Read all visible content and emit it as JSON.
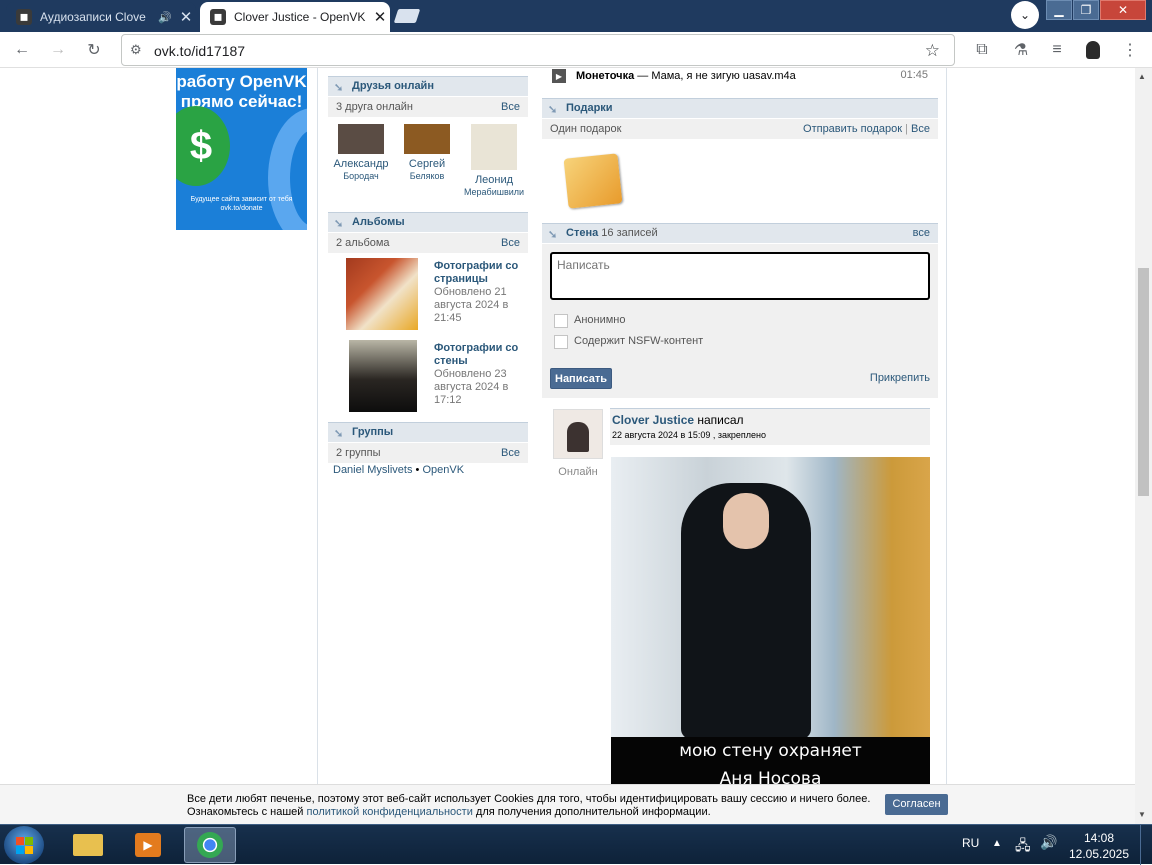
{
  "browser": {
    "tabs": [
      {
        "title": "Аудиозаписи Clove",
        "favicon": "openvk-icon",
        "audio": "speaker-icon",
        "active": false
      },
      {
        "title": "Clover Justice - OpenVK",
        "favicon": "openvk-icon",
        "active": true
      }
    ],
    "url": "ovk.to/id17187"
  },
  "ad": {
    "headline": "работу OpenVK прямо сейчас!",
    "small": "Будущее сайта зависит от тебя ovk.to/donate"
  },
  "friends": {
    "header": "Друзья онлайн",
    "count": "3 друга онлайн",
    "all": "Все",
    "items": [
      {
        "name1": "Александр",
        "name2": "Бородач"
      },
      {
        "name1": "Сергей",
        "name2": "Беляков"
      },
      {
        "name1": "Леонид",
        "name2": "Мерабишвили"
      }
    ]
  },
  "albums": {
    "header": "Альбомы",
    "count": "2 альбома",
    "all": "Все",
    "items": [
      {
        "title": "Фотографии со страницы",
        "updated": "Обновлено 21 августа 2024 в 21:45"
      },
      {
        "title": "Фотографии со стены",
        "updated": "Обновлено 23 августа 2024 в 17:12"
      }
    ]
  },
  "groups": {
    "header": "Группы",
    "count": "2 группы",
    "all": "Все",
    "g1": "Daniel Myslivets",
    "sep": "•",
    "g2": "OpenVK"
  },
  "audio": {
    "artist": "Монеточка",
    "title": " — Мама, я не зигую uasav.m4a",
    "duration": "01:45"
  },
  "gifts": {
    "header": "Подарки",
    "count": "Один подарок",
    "send": "Отправить подарок",
    "sep": "|",
    "all": "Все"
  },
  "wall": {
    "header": "Стена",
    "count": "16 записей",
    "all": "все",
    "placeholder": "Написать",
    "anon": "Анонимно",
    "nsfw": "Содержит NSFW-контент",
    "post_btn": "Написать",
    "attach": "Прикрепить"
  },
  "post": {
    "author": "Clover Justice",
    "action": " написал",
    "date": "22 августа 2024 в 15:09 , закреплено",
    "online": "Онлайн",
    "caption1": "мою стену охраняет",
    "caption2": "Аня Носова"
  },
  "cookie": {
    "line1": "Все дети любят печенье, поэтому этот веб-сайт использует Cookies для того, чтобы идентифицировать вашу сессию и ничего более.",
    "line2a": "Ознакомьтесь с нашей ",
    "line2link": "политикой конфиденциальности",
    "line2b": " для получения дополнительной информации.",
    "button": "Согласен"
  },
  "taskbar": {
    "lang": "RU",
    "time": "14:08",
    "date": "12.05.2025"
  }
}
